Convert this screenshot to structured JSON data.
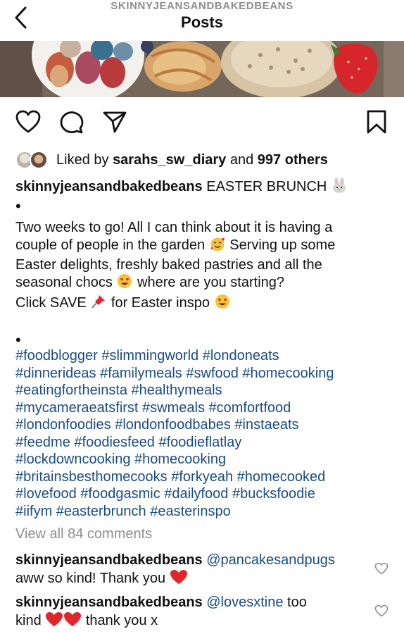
{
  "header": {
    "username": "SKINNYJEANSANDBAKEDBEANS",
    "title": "Posts"
  },
  "post": {
    "image_description_icons": [
      "chocolate-eggs",
      "blueberries",
      "croissant",
      "crumpet",
      "strawberry"
    ],
    "likes": {
      "prefix": "Liked by",
      "user": "sarahs_sw_diary",
      "and": "and",
      "others": "997 others"
    },
    "caption": {
      "username": "skinnyjeansandbakedbeans",
      "title": "EASTER BRUNCH",
      "dot1": "•",
      "line1": "Two weeks to go! All I can think about it is having a",
      "line2a": "couple of people in the garden",
      "line2b": "Serving up some",
      "line3": "Easter delights, freshly baked pastries and all the",
      "line4a": "seasonal chocs",
      "line4b": "where are you starting?",
      "line5a": "Click SAVE",
      "line5b": "for Easter inspo",
      "dot2": "•"
    },
    "hashtags": [
      "#foodblogger #slimmingworld #londoneats",
      "#dinnerideas #familymeals #swfood #homecooking",
      "#eatingfortheinsta #healthymeals",
      "#mycameraeatsfirst #swmeals #comfortfood",
      "#londonfoodies #londonfoodbabes #instaeats",
      "#feedme #foodiesfeed #foodieflatlay",
      "#lockdowncooking #homecooking",
      "#britainsbesthomecooks #forkyeah #homecooked",
      "#lovefood #foodgasmic #dailyfood #bucksfoodie",
      "#iifym #easterbrunch #easterinspo"
    ],
    "view_all_comments": "View all 84 comments",
    "comments": [
      {
        "username": "skinnyjeansandbakedbeans",
        "mention": "@pancakesandpugs",
        "line2": "aww so kind! Thank you"
      },
      {
        "username": "skinnyjeansandbakedbeans",
        "mention": "@lovesxtine",
        "tail": "too",
        "line2a": "kind",
        "line2b": "thank you x"
      }
    ]
  },
  "colors": {
    "hashtag": "#1a4c85",
    "muted": "#8e8e8e",
    "heart_red": "#e0252b"
  }
}
